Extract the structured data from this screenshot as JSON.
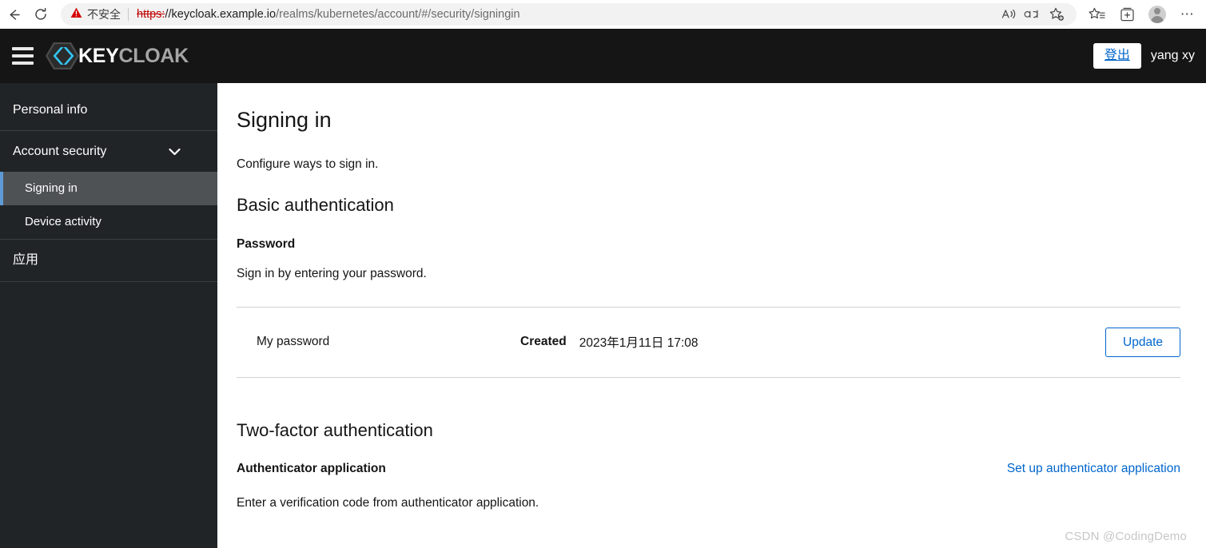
{
  "browser": {
    "back_icon": "back-arrow-icon",
    "reload_icon": "reload-icon",
    "security_label": "不安全",
    "url_scheme": "https:",
    "url_host": "//keycloak.example.io",
    "url_path": "/realms/kubernetes/account/#/security/signingin",
    "read_aloud_icon": "read-aloud-icon",
    "translate_icon": "translate-icon",
    "add_favorite_icon": "add-favorite-icon",
    "favorites_icon": "favorites-icon",
    "collections_icon": "collections-icon",
    "profile_icon": "profile-avatar-icon",
    "more_icon": "more-options-icon"
  },
  "masthead": {
    "menu_icon": "hamburger-menu-icon",
    "logo_icon": "keycloak-logo-icon",
    "brand_first": "KEY",
    "brand_second": "CLOAK",
    "logout_label": "登出",
    "user_name": "yang xy"
  },
  "sidebar": {
    "items": [
      {
        "label": "Personal info"
      },
      {
        "label": "Account security",
        "chevron_icon": "chevron-down-icon"
      }
    ],
    "sub_items": [
      {
        "label": "Signing in",
        "active": true
      },
      {
        "label": "Device activity",
        "active": false
      }
    ],
    "apps_label": "应用"
  },
  "main": {
    "page_title": "Signing in",
    "intro": "Configure ways to sign in.",
    "basic_auth": {
      "section_title": "Basic authentication",
      "sub_title": "Password",
      "description": "Sign in by entering your password.",
      "credential": {
        "name": "My password",
        "created_label": "Created",
        "created_value": "2023年1月11日 17:08",
        "update_label": "Update"
      }
    },
    "two_factor": {
      "section_title": "Two-factor authentication",
      "sub_title": "Authenticator application",
      "description": "Enter a verification code from authenticator application.",
      "setup_link": "Set up authenticator application"
    }
  },
  "watermark": "CSDN @CodingDemo",
  "colors": {
    "masthead_bg": "#151515",
    "sidebar_bg": "#212427",
    "active_item_bg": "#4f5255",
    "accent_blue": "#5e9bd6",
    "link_blue": "#0066cc",
    "danger_red": "#c00000"
  }
}
